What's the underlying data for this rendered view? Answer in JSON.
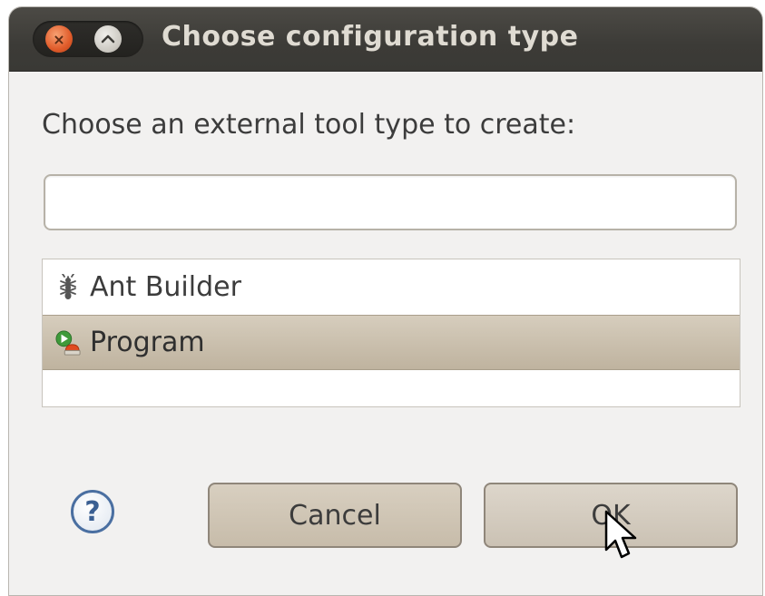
{
  "window": {
    "title": "Choose configuration type",
    "close_icon": "close-icon",
    "maximize_icon": "maximize-icon"
  },
  "dialog": {
    "prompt": "Choose an external tool type to create:",
    "filter_value": "",
    "filter_placeholder": ""
  },
  "list": {
    "items": [
      {
        "label": "Ant Builder",
        "icon": "ant-icon",
        "selected": false
      },
      {
        "label": "Program",
        "icon": "program-launch-icon",
        "selected": true
      }
    ]
  },
  "buttons": {
    "help_label": "?",
    "cancel_label": "Cancel",
    "ok_label": "OK"
  },
  "colors": {
    "titlebar": "#3c3b37",
    "selection": "#c7bcaa",
    "close_button": "#e05b2a",
    "help_blue": "#4a6fa1"
  }
}
